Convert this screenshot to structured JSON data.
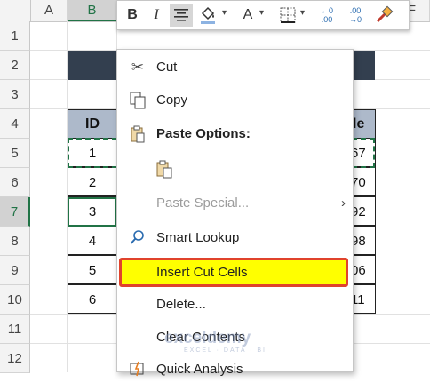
{
  "columns": [
    "A",
    "B",
    "C",
    "D",
    "E",
    "F"
  ],
  "rows": [
    "1",
    "2",
    "3",
    "4",
    "5",
    "6",
    "7",
    "8",
    "9",
    "10",
    "11",
    "12"
  ],
  "table": {
    "header_left": "ID",
    "header_right_fragment": "le",
    "ids": [
      "1",
      "2",
      "3",
      "4",
      "5",
      "6"
    ],
    "right_fragments": [
      "67",
      "70",
      "92",
      "98",
      "06",
      "11"
    ]
  },
  "mini_toolbar": {
    "bold": "B",
    "italic": "I",
    "font_color_letter": "A",
    "increase_decimal": "←0\n.00",
    "decrease_decimal": ".00\n→0"
  },
  "context_menu": {
    "cut": "Cut",
    "copy": "Copy",
    "paste_options": "Paste Options:",
    "paste_special": "Paste Special...",
    "smart_lookup": "Smart Lookup",
    "insert_cut_cells": "Insert Cut Cells",
    "delete": "Delete...",
    "clear_contents": "Clear Contents",
    "quick_analysis": "Quick Analysis"
  },
  "watermark": {
    "name": "exceldemy",
    "tagline": "EXCEL · DATA · BI"
  },
  "colors": {
    "accent_green": "#217346",
    "highlight_yellow": "#ffff00",
    "highlight_border": "#e0432c",
    "title_bar": "#333f4f",
    "table_header": "#adb9ca"
  },
  "icons": [
    "scissors-icon",
    "copy-icon",
    "clipboard-icon",
    "magnifier-icon",
    "format-painter-icon",
    "borders-icon",
    "fill-color-icon",
    "align-center-icon"
  ]
}
